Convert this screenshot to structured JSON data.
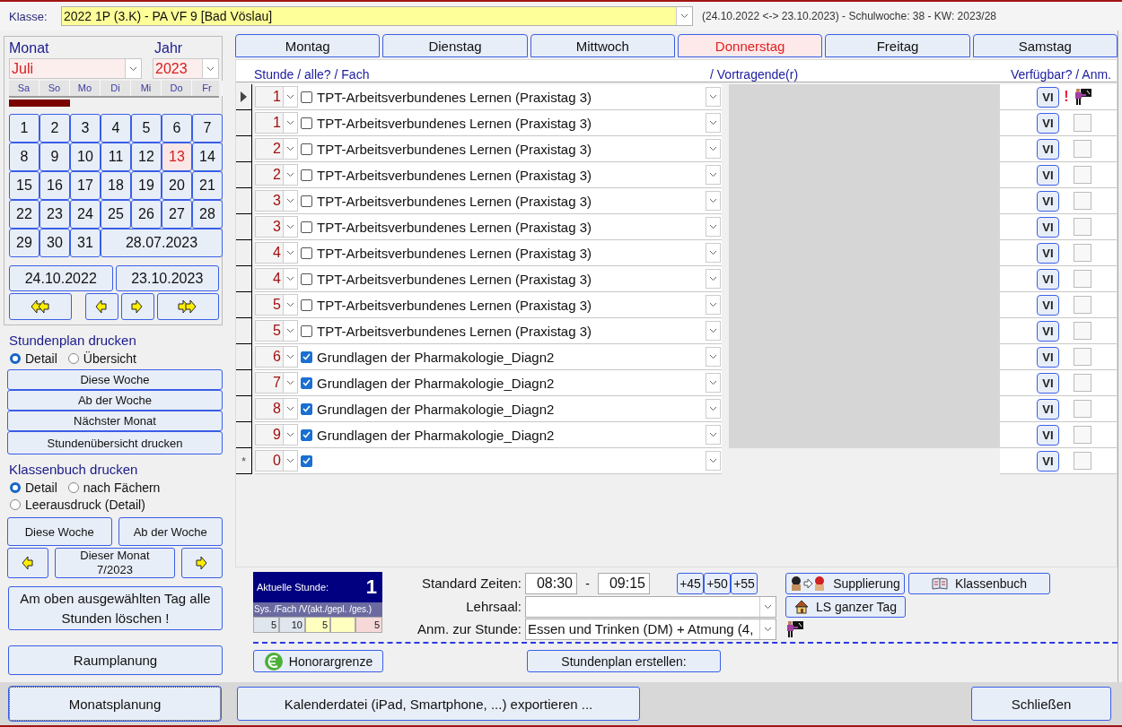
{
  "class_selector": {
    "label": "Klasse:",
    "value": "2022 1P (3.K) - PA VF 9  [Bad Vöslau]"
  },
  "period_info": "(24.10.2022 <-> 23.10.2023) - Schulwoche: 38 - KW: 2023/28",
  "calendar": {
    "month_label": "Monat",
    "month": "Juli",
    "year_label": "Jahr",
    "year": "2023",
    "weekdays": [
      "Sa",
      "So",
      "Mo",
      "Di",
      "Mi",
      "Do",
      "Fr"
    ],
    "days": [
      {
        "label": "1",
        "selected": false
      },
      {
        "label": "2",
        "selected": false
      },
      {
        "label": "3",
        "selected": false
      },
      {
        "label": "4",
        "selected": false
      },
      {
        "label": "5",
        "selected": false
      },
      {
        "label": "6",
        "selected": false
      },
      {
        "label": "7",
        "selected": false
      },
      {
        "label": "8",
        "selected": false
      },
      {
        "label": "9",
        "selected": false
      },
      {
        "label": "10",
        "selected": false
      },
      {
        "label": "11",
        "selected": false
      },
      {
        "label": "12",
        "selected": false
      },
      {
        "label": "13",
        "selected": true
      },
      {
        "label": "14",
        "selected": false
      },
      {
        "label": "15",
        "selected": false
      },
      {
        "label": "16",
        "selected": false
      },
      {
        "label": "17",
        "selected": false
      },
      {
        "label": "18",
        "selected": false
      },
      {
        "label": "19",
        "selected": false
      },
      {
        "label": "20",
        "selected": false
      },
      {
        "label": "21",
        "selected": false
      },
      {
        "label": "22",
        "selected": false
      },
      {
        "label": "23",
        "selected": false
      },
      {
        "label": "24",
        "selected": false
      },
      {
        "label": "25",
        "selected": false
      },
      {
        "label": "26",
        "selected": false
      },
      {
        "label": "27",
        "selected": false
      },
      {
        "label": "28",
        "selected": false
      },
      {
        "label": "29",
        "selected": false
      },
      {
        "label": "30",
        "selected": false
      },
      {
        "label": "31",
        "selected": false
      }
    ],
    "date_button": "28.07.2023",
    "range": [
      "24.10.2022",
      "23.10.2023"
    ]
  },
  "timetable_print": {
    "title": "Stundenplan drucken",
    "options": [
      {
        "label": "Detail",
        "selected": true
      },
      {
        "label": "Übersicht",
        "selected": false
      }
    ],
    "buttons": [
      "Diese Woche",
      "Ab der Woche",
      "Nächster Monat",
      "Stundenübersicht drucken"
    ]
  },
  "classbook_print": {
    "title": "Klassenbuch drucken",
    "options": [
      {
        "label": "Detail",
        "selected": true
      },
      {
        "label": "nach Fächern",
        "selected": false
      },
      {
        "label": "Leerausdruck (Detail)",
        "selected": false
      }
    ],
    "buttons": [
      "Diese Woche",
      "Ab der Woche"
    ],
    "month_button": [
      "Dieser Monat",
      "7/2023"
    ]
  },
  "delete_button": "Am oben ausgewählten Tag alle Stunden löschen !",
  "room_button": "Raumplanung",
  "day_tabs": [
    {
      "label": "Montag",
      "selected": false
    },
    {
      "label": "Dienstag",
      "selected": false
    },
    {
      "label": "Mittwoch",
      "selected": false
    },
    {
      "label": "Donnerstag",
      "selected": true
    },
    {
      "label": "Freitag",
      "selected": false
    },
    {
      "label": "Samstag",
      "selected": false
    }
  ],
  "lessons": {
    "headers": [
      "Stunde / alle? / Fach",
      "/ Vortragende(r)",
      "Verfügbar?  / Anm."
    ],
    "rows": [
      {
        "stunde": "1",
        "checked": false,
        "fach": "TPT-Arbeitsverbundenes Lernen (Praxistag 3)",
        "current": true,
        "available": "VI",
        "alert": "!",
        "note": true
      },
      {
        "stunde": "1",
        "checked": false,
        "fach": "TPT-Arbeitsverbundenes Lernen (Praxistag 3)",
        "current": false,
        "available": "VI",
        "note": false
      },
      {
        "stunde": "2",
        "checked": false,
        "fach": "TPT-Arbeitsverbundenes Lernen (Praxistag 3)",
        "current": false,
        "available": "VI",
        "note": false
      },
      {
        "stunde": "2",
        "checked": false,
        "fach": "TPT-Arbeitsverbundenes Lernen (Praxistag 3)",
        "current": false,
        "available": "VI",
        "note": false
      },
      {
        "stunde": "3",
        "checked": false,
        "fach": "TPT-Arbeitsverbundenes Lernen (Praxistag 3)",
        "current": false,
        "available": "VI",
        "note": false
      },
      {
        "stunde": "3",
        "checked": false,
        "fach": "TPT-Arbeitsverbundenes Lernen (Praxistag 3)",
        "current": false,
        "available": "VI",
        "note": false
      },
      {
        "stunde": "4",
        "checked": false,
        "fach": "TPT-Arbeitsverbundenes Lernen (Praxistag 3)",
        "current": false,
        "available": "VI",
        "note": false
      },
      {
        "stunde": "4",
        "checked": false,
        "fach": "TPT-Arbeitsverbundenes Lernen (Praxistag 3)",
        "current": false,
        "available": "VI",
        "note": false
      },
      {
        "stunde": "5",
        "checked": false,
        "fach": "TPT-Arbeitsverbundenes Lernen (Praxistag 3)",
        "current": false,
        "available": "VI",
        "note": false
      },
      {
        "stunde": "5",
        "checked": false,
        "fach": "TPT-Arbeitsverbundenes Lernen (Praxistag 3)",
        "current": false,
        "available": "VI",
        "note": false
      },
      {
        "stunde": "6",
        "checked": true,
        "fach": "Grundlagen der Pharmakologie_Diagn2",
        "current": false,
        "available": "VI",
        "note": false
      },
      {
        "stunde": "7",
        "checked": true,
        "fach": "Grundlagen der Pharmakologie_Diagn2",
        "current": false,
        "available": "VI",
        "note": false
      },
      {
        "stunde": "8",
        "checked": true,
        "fach": "Grundlagen der Pharmakologie_Diagn2",
        "current": false,
        "available": "VI",
        "note": false
      },
      {
        "stunde": "9",
        "checked": true,
        "fach": "Grundlagen der Pharmakologie_Diagn2",
        "current": false,
        "available": "VI",
        "note": false
      }
    ],
    "new_row": {
      "marker": "*",
      "stunde": "0",
      "checked": true,
      "available": "VI",
      "note": false
    }
  },
  "current_lesson": {
    "title": "Aktuelle Stunde:",
    "value": "1",
    "header": "Sys. /Fach /V(akt./gepl. /ges.)",
    "cells": [
      {
        "value": "5",
        "color": "#dfe6ee"
      },
      {
        "value": "10",
        "color": "#dfe6ee"
      },
      {
        "value": "5",
        "color": "#ffffc0"
      },
      {
        "color": "#ffffc0"
      },
      {
        "value": "5",
        "color": "#f6d8d8"
      }
    ]
  },
  "standard_times": {
    "label": "Standard Zeiten:",
    "from": "08:30",
    "separator": "-",
    "to": "09:15",
    "increments": [
      "+45",
      "+50",
      "+55"
    ]
  },
  "room": {
    "label": "Lehrsaal:"
  },
  "lesson_note": {
    "label": "Anm. zur Stunde:",
    "value": "Essen und Trinken (DM) + Atmung (4,"
  },
  "action_buttons": [
    {
      "label": "Supplierung",
      "kind": "swap"
    },
    {
      "label": "Klassenbuch",
      "kind": "book"
    },
    {
      "label": "LS ganzer Tag",
      "kind": "house"
    }
  ],
  "honorar_button": "Honorargrenze",
  "create_button": "Stundenplan erstellen:",
  "footer_buttons": [
    {
      "label": "Monatsplanung",
      "focused": true
    },
    {
      "label": "Kalenderdatei (iPad, Smartphone, ...) exportieren ...",
      "focused": false
    },
    {
      "label": "Schließen",
      "focused": false
    }
  ]
}
